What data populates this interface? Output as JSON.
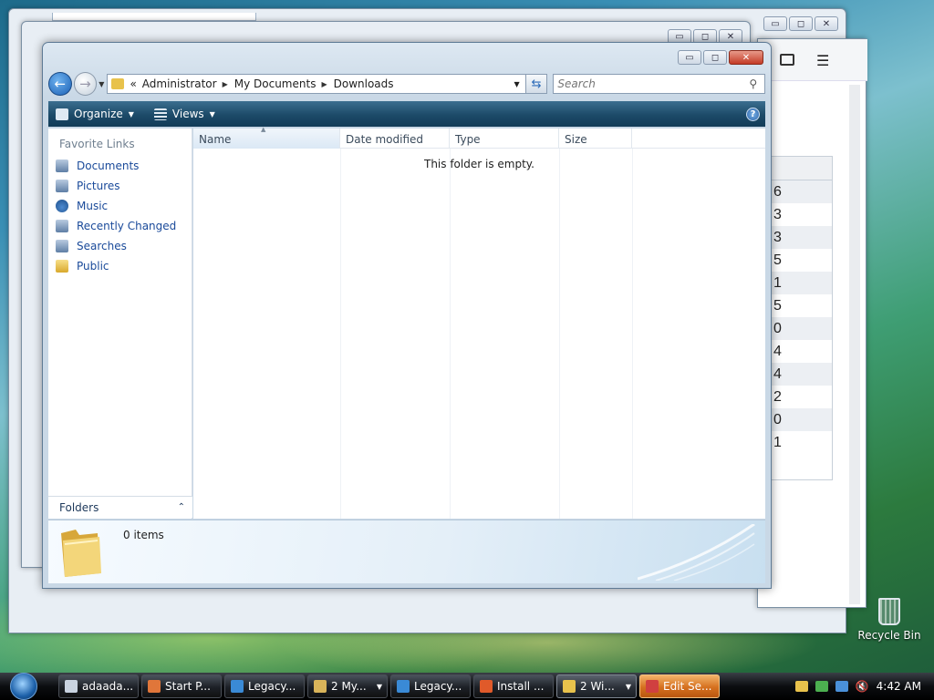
{
  "explorer": {
    "breadcrumb": [
      "Administrator",
      "My Documents",
      "Downloads"
    ],
    "breadcrumb_overflow": "«",
    "search_placeholder": "Search",
    "toolbar": {
      "organize": "Organize",
      "views": "Views"
    },
    "favorite_links_title": "Favorite Links",
    "favorites": [
      "Documents",
      "Pictures",
      "Music",
      "Recently Changed",
      "Searches",
      "Public"
    ],
    "folders_label": "Folders",
    "columns": [
      "Name",
      "Date modified",
      "Type",
      "Size"
    ],
    "empty_message": "This folder is empty.",
    "item_count": "0 items"
  },
  "background_window": {
    "visible_digits": [
      "6",
      "3",
      "3",
      "5",
      "1",
      "5",
      "0",
      "4",
      "4",
      "2",
      "0",
      "1"
    ]
  },
  "desktop": {
    "recycle_bin_label": "Recycle Bin"
  },
  "taskbar": {
    "items": [
      {
        "label": "adaada...",
        "icon": "notepad-icon",
        "color": "#c9d3e0"
      },
      {
        "label": "Start P...",
        "icon": "firefox-icon",
        "color": "#e0763a"
      },
      {
        "label": "Legacy...",
        "icon": "ie-icon",
        "color": "#3a8ad6"
      },
      {
        "label": "2 My...",
        "icon": "network-icon",
        "color": "#d9b45a",
        "dropdown": true
      },
      {
        "label": "Legacy...",
        "icon": "upload-icon",
        "color": "#3a8ad6"
      },
      {
        "label": "Install ...",
        "icon": "windows-icon",
        "color": "#e05a2a"
      },
      {
        "label": "2 Wi...",
        "icon": "folder-icon",
        "color": "#e8c24c",
        "dropdown": true,
        "active": true
      },
      {
        "label": "Edit Se...",
        "icon": "shield-icon",
        "color": "#d04040",
        "highlight": true
      }
    ],
    "clock": "4:42 AM"
  }
}
